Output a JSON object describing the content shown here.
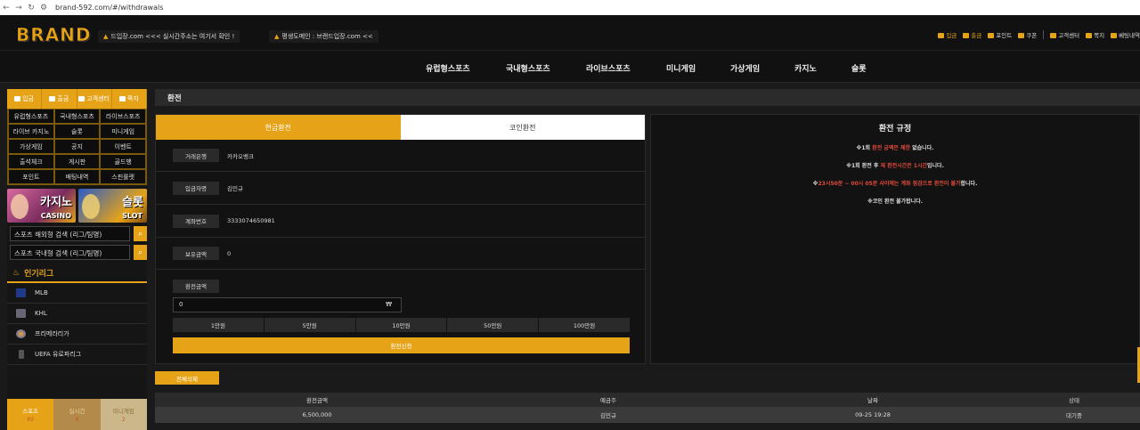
{
  "browser": {
    "url": "brand-592.com/#/withdrawals"
  },
  "header": {
    "logo": "BRAND",
    "notices": [
      "드입장.com <<< 실시간주소는 여기서 확인 !",
      "평생도메인 : 브랜드입장.com <<"
    ],
    "links": [
      "입금",
      "출금",
      "포인트",
      "쿠폰",
      "고객센터",
      "쪽지",
      "베팅내역"
    ]
  },
  "nav": [
    "유럽형스포츠",
    "국내형스포츠",
    "라이브스포츠",
    "미니게임",
    "가상게임",
    "카지노",
    "슬롯"
  ],
  "sidebar": {
    "top": [
      "입금",
      "출금",
      "고객센터",
      "쪽지"
    ],
    "grid": [
      "유럽형스포츠",
      "국내형스포츠",
      "라이브스포츠",
      "라이브 카지노",
      "슬롯",
      "미니게임",
      "가상게임",
      "공지",
      "이벤트",
      "출석체크",
      "게시판",
      "골드뱅",
      "포인트",
      "배팅내역",
      "스핀룰렛"
    ],
    "banners": [
      {
        "big": "카지노",
        "small": "CASINO"
      },
      {
        "big": "슬롯",
        "small": "SLOT"
      }
    ],
    "search": [
      "스포츠 해외형 검색 (리그/팀명)",
      "스포츠 국내형 검색 (리그/팀명)"
    ],
    "popular_title": "인기리그",
    "leagues": [
      "MLB",
      "KHL",
      "프리메라리가",
      "UEFA 유로파리그"
    ],
    "bottom_tabs": [
      {
        "label": "스포츠",
        "count": "89"
      },
      {
        "label": "실시간",
        "count": "8"
      },
      {
        "label": "미니게임",
        "count": "2"
      }
    ]
  },
  "page": {
    "title": "환전",
    "tabs": [
      "현금환전",
      "코인환전"
    ],
    "fields": [
      {
        "label": "거래은행",
        "value": "카카오뱅크"
      },
      {
        "label": "입금자명",
        "value": "김민규"
      },
      {
        "label": "계좌번호",
        "value": "3333074650981"
      },
      {
        "label": "보유금액",
        "value": "0"
      }
    ],
    "amount_label": "환전금액",
    "amount_value": "0",
    "currency": "₩",
    "chips": [
      "1만원",
      "5만원",
      "10만원",
      "50만원",
      "100만원"
    ],
    "submit": "환전신청",
    "delete_all": "전체삭제"
  },
  "rules": {
    "title": "환전 규정",
    "line1_a": "※1회 ",
    "line1_b": "환전 금액은 제한",
    "line1_c": " 없습니다.",
    "line2_a": "※1회 환전 후 ",
    "line2_b": "재 환전시간은 1시간",
    "line2_c": "입니다.",
    "line3_a": "※",
    "line3_b": "23시50분 ~ 00시 05분 사이에는 계좌 점검으로 환전이 불가",
    "line3_c": "합니다.",
    "line4": "※코인 환전 불가합니다."
  },
  "table": {
    "headers": [
      "환전금액",
      "예금주",
      "날짜",
      "상태"
    ],
    "rows": [
      [
        "6,500,000",
        "김민규",
        "09-25 19:28",
        "대기중"
      ]
    ]
  }
}
